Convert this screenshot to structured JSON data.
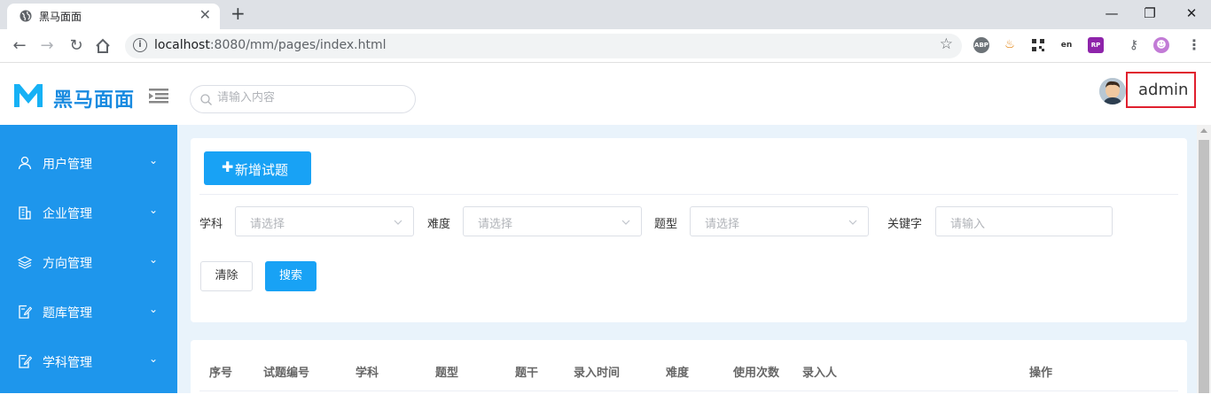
{
  "browser": {
    "tab_title": "黑马面面",
    "tab_close": "✕",
    "new_tab": "+",
    "url_host": "localhost",
    "url_rest": ":8080/mm/pages/index.html",
    "window_minimize": "—",
    "window_restore": "❐",
    "window_close": "✕",
    "extensions": [
      "ABP",
      "java",
      "qr",
      "en",
      "RP",
      "key",
      "profile"
    ]
  },
  "header": {
    "app_name": "黑马面面",
    "search_placeholder": "请输入内容",
    "user_name": "admin"
  },
  "sidebar": {
    "items": [
      {
        "label": "用户管理",
        "icon": "user-icon"
      },
      {
        "label": "企业管理",
        "icon": "building-icon"
      },
      {
        "label": "方向管理",
        "icon": "layers-icon"
      },
      {
        "label": "题库管理",
        "icon": "edit-doc-icon"
      },
      {
        "label": "学科管理",
        "icon": "edit-doc-icon"
      }
    ],
    "chevron": "⌄"
  },
  "toolbar": {
    "add_label": "新增试题",
    "add_plus": "✚"
  },
  "filters": {
    "subject_label": "学科",
    "subject_placeholder": "请选择",
    "difficulty_label": "难度",
    "difficulty_placeholder": "请选择",
    "type_label": "题型",
    "type_placeholder": "请选择",
    "keyword_label": "关键字",
    "keyword_placeholder": "请输入",
    "clear_label": "清除",
    "search_label": "搜索"
  },
  "table": {
    "headers": [
      "序号",
      "试题编号",
      "学科",
      "题型",
      "题干",
      "录入时间",
      "难度",
      "使用次数",
      "录入人",
      "操作"
    ]
  },
  "colors": {
    "accent": "#18a2f5",
    "sidebar": "#1e96ec",
    "highlight_border": "#e0202e"
  }
}
